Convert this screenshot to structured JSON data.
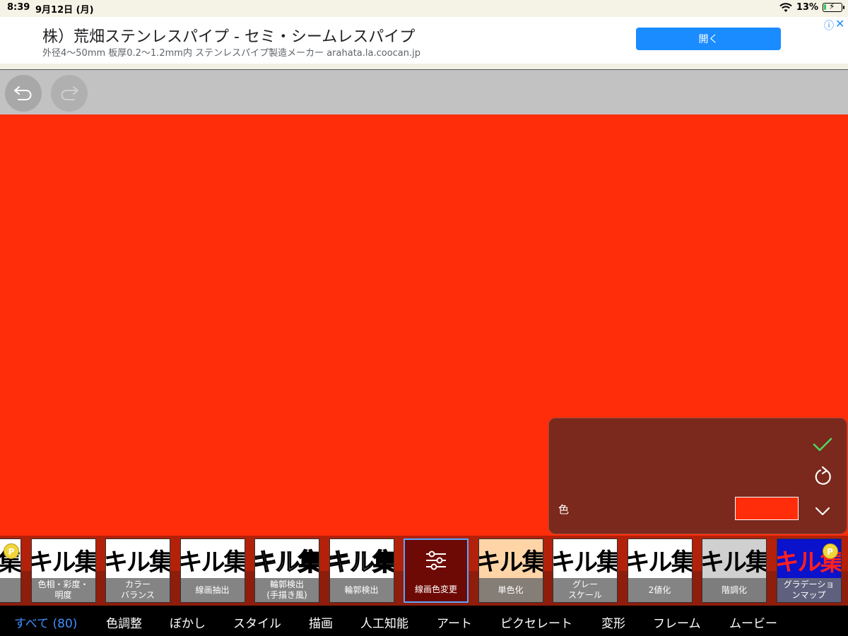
{
  "status_bar": {
    "time": "8:39",
    "date": "9月12日 (月)",
    "battery": "13%",
    "battery_level": 0.13,
    "icons": [
      "wifi-icon",
      "battery-charging-icon"
    ]
  },
  "ad": {
    "title": "株）荒畑ステンレスパイプ - セミ・シームレスパイプ",
    "description": "外径4〜50mm 板厚0.2〜1.2mm内 ステンレスパイプ製造メーカー arahata.la.coocan.jp",
    "open_label": "開く",
    "open_color": "#1a8cff"
  },
  "toolbar": {
    "icons": [
      "undo-icon",
      "redo-icon"
    ]
  },
  "canvas": {
    "color": "#ff2d0a"
  },
  "settings": {
    "color_label": "色",
    "color_value": "#ff2d0a",
    "icons": [
      "check-icon",
      "reset-icon",
      "chevron-down-icon"
    ]
  },
  "filters": [
    {
      "thumb": "集",
      "label": "ープ",
      "badge": "P"
    },
    {
      "thumb": "キル集",
      "label": "色相・彩度・\n明度"
    },
    {
      "thumb": "キル集",
      "label": "カラー\nバランス"
    },
    {
      "thumb": "キル集",
      "label": "線画抽出"
    },
    {
      "thumb": "キル集",
      "label": "輪郭検出\n(手描き風)"
    },
    {
      "thumb": "キル集",
      "label": "輪郭検出"
    },
    {
      "thumb": "",
      "label": "線画色変更",
      "selected": true
    },
    {
      "thumb": "キル集",
      "label": "単色化"
    },
    {
      "thumb": "キル集",
      "label": "グレー\nスケール"
    },
    {
      "thumb": "キル集",
      "label": "2値化"
    },
    {
      "thumb": "キル集",
      "label": "階調化"
    },
    {
      "thumb": "キル集",
      "label": "グラデーショ\nンマップ",
      "badge": "P"
    }
  ],
  "categories": [
    {
      "label": "すべて (80)",
      "active": true
    },
    {
      "label": "色調整"
    },
    {
      "label": "ぼかし"
    },
    {
      "label": "スタイル"
    },
    {
      "label": "描画"
    },
    {
      "label": "人工知能"
    },
    {
      "label": "アート"
    },
    {
      "label": "ピクセレート"
    },
    {
      "label": "変形"
    },
    {
      "label": "フレーム"
    },
    {
      "label": "ムービー"
    }
  ]
}
